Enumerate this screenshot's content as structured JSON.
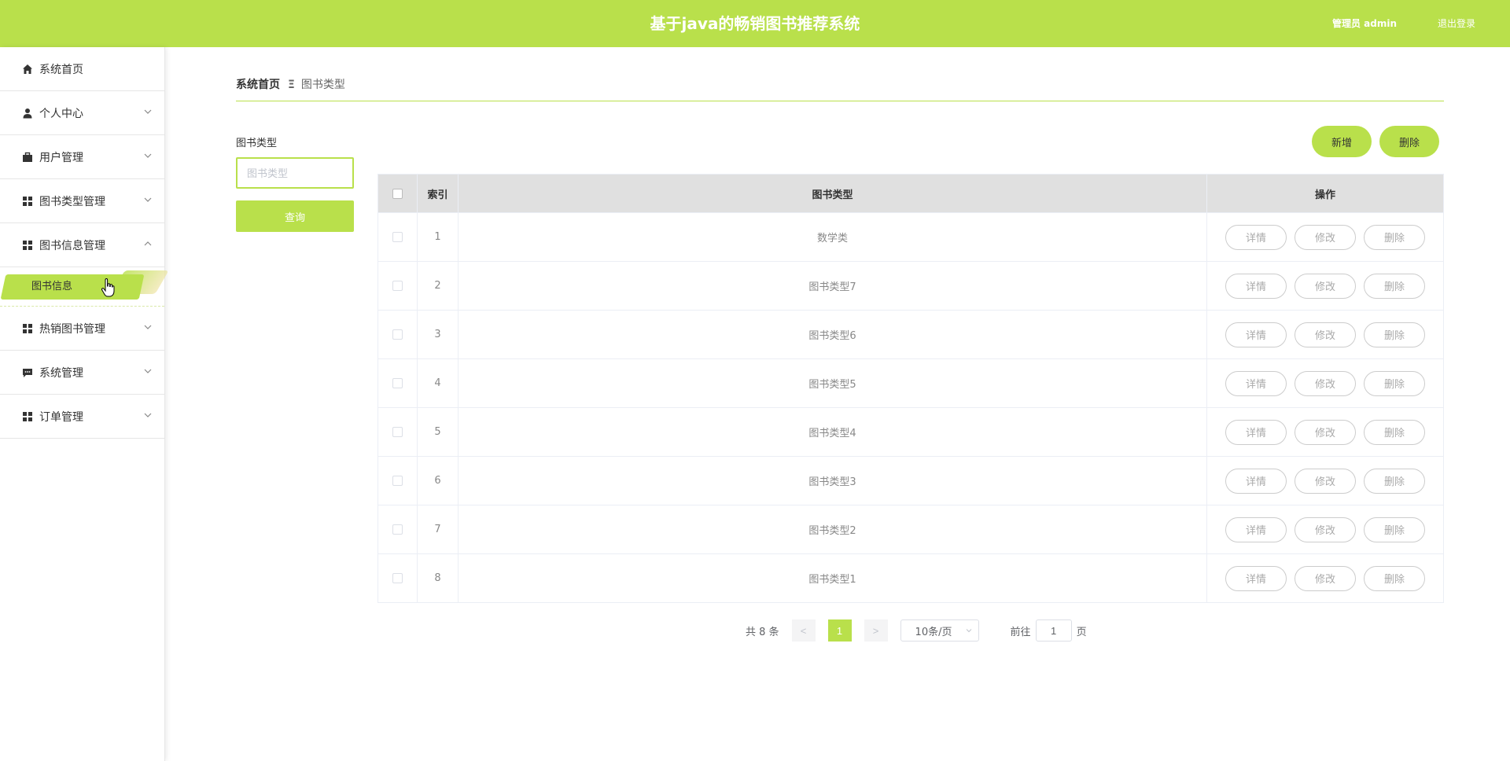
{
  "header": {
    "title": "基于java的畅销图书推荐系统",
    "admin_label": "管理员 admin",
    "logout_label": "退出登录"
  },
  "sidebar": {
    "items": [
      {
        "label": "系统首页",
        "icon": "home-icon"
      },
      {
        "label": "个人中心",
        "icon": "user-icon"
      },
      {
        "label": "用户管理",
        "icon": "briefcase-icon"
      },
      {
        "label": "图书类型管理",
        "icon": "grid-icon"
      },
      {
        "label": "图书信息管理",
        "icon": "grid-icon",
        "expanded": true
      },
      {
        "label": "热销图书管理",
        "icon": "grid-icon"
      },
      {
        "label": "系统管理",
        "icon": "chat-icon"
      },
      {
        "label": "订单管理",
        "icon": "grid-icon"
      }
    ],
    "active_subitem": "图书信息"
  },
  "breadcrumb": {
    "home": "系统首页",
    "separator": "Ξ",
    "current": "图书类型"
  },
  "filter": {
    "label": "图书类型",
    "placeholder": "图书类型",
    "value": "",
    "query_label": "查询"
  },
  "actions": {
    "add_label": "新增",
    "delete_label": "删除"
  },
  "table": {
    "headers": {
      "index": "索引",
      "type": "图书类型",
      "ops": "操作"
    },
    "op_labels": {
      "detail": "详情",
      "edit": "修改",
      "delete": "删除"
    },
    "rows": [
      {
        "index": "1",
        "type": "数学类"
      },
      {
        "index": "2",
        "type": "图书类型7"
      },
      {
        "index": "3",
        "type": "图书类型6"
      },
      {
        "index": "4",
        "type": "图书类型5"
      },
      {
        "index": "5",
        "type": "图书类型4"
      },
      {
        "index": "6",
        "type": "图书类型3"
      },
      {
        "index": "7",
        "type": "图书类型2"
      },
      {
        "index": "8",
        "type": "图书类型1"
      }
    ]
  },
  "pagination": {
    "total_text": "共 8 条",
    "prev": "<",
    "current_page": "1",
    "next": ">",
    "page_size": "10条/页",
    "goto_label": "前往",
    "goto_value": "1",
    "page_suffix": "页"
  },
  "colors": {
    "accent": "#b9e04b"
  }
}
